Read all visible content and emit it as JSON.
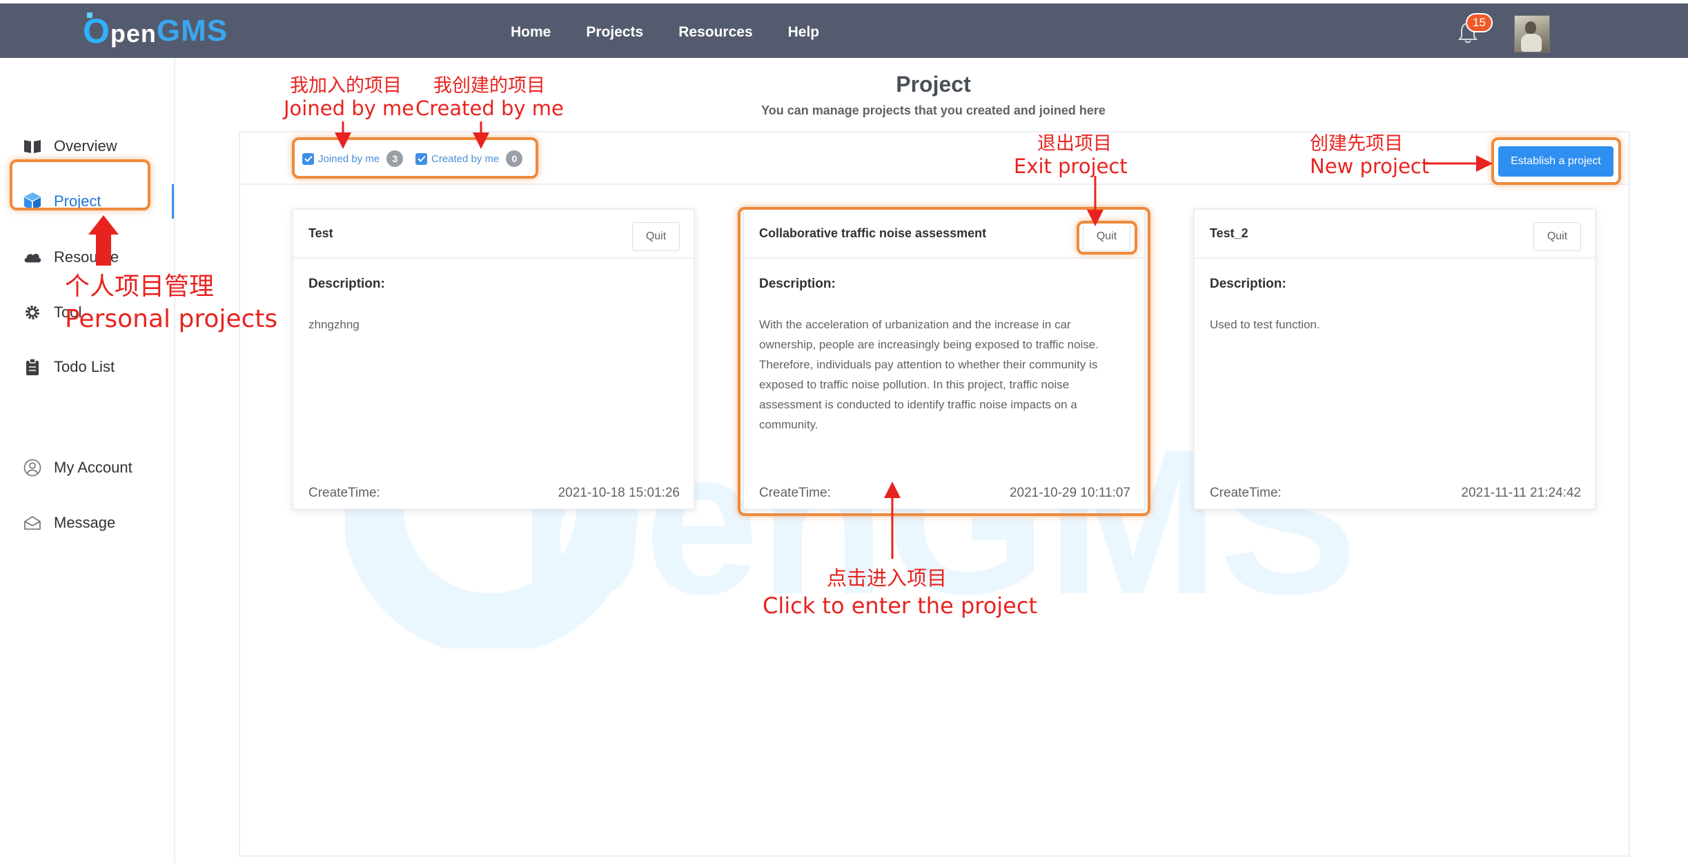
{
  "app": {
    "brand": {
      "o": "O",
      "pen": "pen",
      "gms": "GMS"
    }
  },
  "nav": [
    {
      "label": "Home"
    },
    {
      "label": "Projects"
    },
    {
      "label": "Resources"
    },
    {
      "label": "Help"
    }
  ],
  "notifications": {
    "count": "15"
  },
  "sidebar": {
    "items": [
      {
        "label": "Overview",
        "icon": "book-icon"
      },
      {
        "label": "Project",
        "icon": "cube-icon",
        "active": true
      },
      {
        "label": "Resource",
        "icon": "cloud-icon"
      },
      {
        "label": "Tool",
        "icon": "gear-icon"
      },
      {
        "label": "Todo List",
        "icon": "clipboard-icon"
      },
      {
        "label": "My Account",
        "icon": "user-icon"
      },
      {
        "label": "Message",
        "icon": "envelope-icon"
      }
    ]
  },
  "header": {
    "title": "Project",
    "subtitle": "You can manage projects that you created and joined here"
  },
  "filters": {
    "joined": {
      "label": "Joined by me",
      "count": "3",
      "checked": true
    },
    "created": {
      "label": "Created by me",
      "count": "0",
      "checked": true
    }
  },
  "actions": {
    "establish_label": "Establish a project"
  },
  "cards": [
    {
      "title": "Test",
      "quit_label": "Quit",
      "desc_label": "Description:",
      "description": "zhngzhng",
      "createtime_label": "CreateTime:",
      "createtime": "2021-10-18 15:01:26"
    },
    {
      "title": "Collaborative traffic noise assessment",
      "quit_label": "Quit",
      "desc_label": "Description:",
      "description": "With the acceleration of urbanization and the increase in car ownership, people are increasingly being exposed to traffic noise. Therefore, individuals pay attention to whether their community is exposed to traffic noise pollution. In this project, traffic noise assessment is conducted to identify traffic noise impacts on a community.",
      "createtime_label": "CreateTime:",
      "createtime": "2021-10-29 10:11:07"
    },
    {
      "title": "Test_2",
      "quit_label": "Quit",
      "desc_label": "Description:",
      "description": "Used to test function.",
      "createtime_label": "CreateTime:",
      "createtime": "2021-11-11 21:24:42"
    }
  ],
  "annotations": {
    "joined": {
      "zh": "我加入的项目",
      "en": "Joined by me"
    },
    "created": {
      "zh": "我创建的项目",
      "en": "Created by me"
    },
    "exit": {
      "zh": "退出项目",
      "en": "Exit project"
    },
    "new": {
      "zh": "创建先项目",
      "en": "New project"
    },
    "personal": {
      "zh": "个人项目管理",
      "en": "Personal projects"
    },
    "enter": {
      "zh": "点击进入项目",
      "en": "Click to enter the project"
    }
  },
  "colors": {
    "topbar": "#555b6e",
    "accent": "#2f8ff0",
    "annotation_text": "#e8231f",
    "annotation_box": "#ee8a3c"
  }
}
